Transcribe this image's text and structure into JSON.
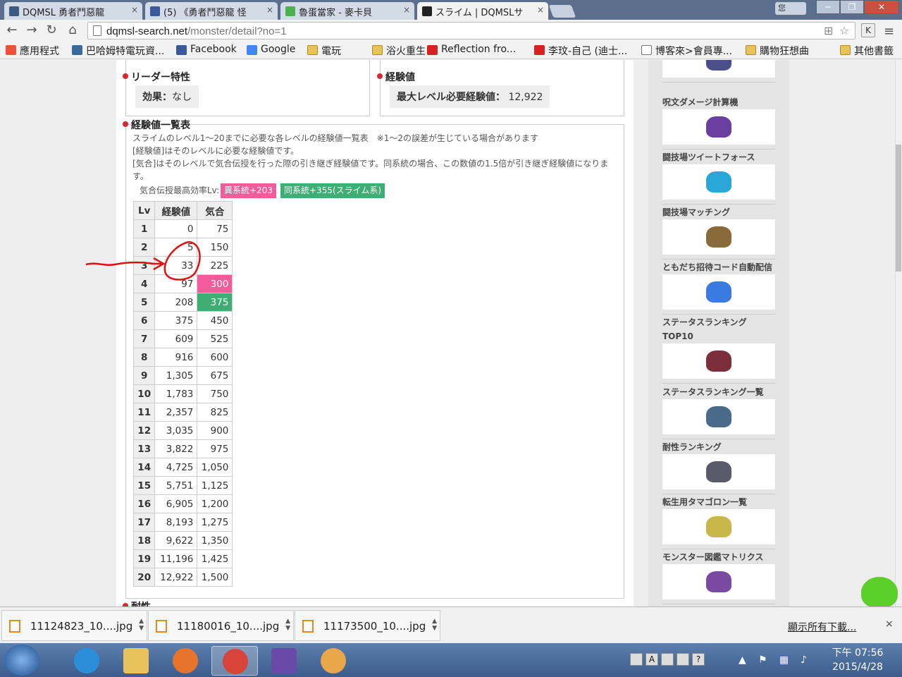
{
  "browser": {
    "tabs": [
      {
        "label": "DQMSL 勇者鬥惡龍",
        "icon_color": "#3c5a80"
      },
      {
        "label": "(5) 《勇者鬥惡龍 怪",
        "icon_color": "#3b5998"
      },
      {
        "label": "魯蛋當家 - 麥卡貝",
        "icon_color": "#4caf50"
      },
      {
        "label": "スライム | DQMSLサ",
        "icon_color": "#222222"
      }
    ],
    "tab_close": "×",
    "user_badge": "您",
    "window_buttons": {
      "minimize": "─",
      "maximize": "❐",
      "close": "✕"
    },
    "url_host": "dqmsl-search.net",
    "url_path": "/monster/detail?no=1",
    "extension_label": "K",
    "bookmarks": [
      {
        "label": "應用程式",
        "kind": "apps"
      },
      {
        "label": "巴哈姆特電玩資...",
        "kind": "site"
      },
      {
        "label": "Facebook",
        "kind": "facebook"
      },
      {
        "label": "Google",
        "kind": "google"
      },
      {
        "label": "電玩",
        "kind": "folder"
      },
      {
        "label": "浴火重生!!!",
        "kind": "folder"
      },
      {
        "label": "Reflection fro...",
        "kind": "youtube"
      },
      {
        "label": "李玟-自己 (迪士...",
        "kind": "youtube"
      },
      {
        "label": "博客來>會員專...",
        "kind": "page"
      },
      {
        "label": "購物狂想曲",
        "kind": "folder"
      },
      {
        "label": "其他書籤",
        "kind": "folder"
      }
    ]
  },
  "page": {
    "leader": {
      "heading": "リーダー特性",
      "label": "効果：",
      "value": "なし"
    },
    "experience": {
      "heading": "経験値",
      "label": "最大レベル必要経験値：",
      "value": "12,922"
    },
    "exp_table": {
      "heading": "経験値一覧表",
      "desc_lines": [
        "スライムのレベル1～20までに必要な各レベルの経験値一覧表　※1～2の誤差が生じている場合があります",
        "[経験値]はそのレベルに必要な経験値です。",
        "[気合]はそのレベルで気合伝授を行った際の引き継ぎ経験値です。同系統の場合、この数値の1.5倍が引き継ぎ経験値になりま",
        "す。"
      ],
      "efficiency_label": "気合伝授最高効率Lv:",
      "tag_other": "異系統+203",
      "tag_same": "同系統+355(スライム系)",
      "columns": [
        "Lv",
        "経験値",
        "気合"
      ],
      "rows": [
        [
          "1",
          "0",
          "75"
        ],
        [
          "2",
          "5",
          "150"
        ],
        [
          "3",
          "33",
          "225"
        ],
        [
          "4",
          "97",
          "300"
        ],
        [
          "5",
          "208",
          "375"
        ],
        [
          "6",
          "375",
          "450"
        ],
        [
          "7",
          "609",
          "525"
        ],
        [
          "8",
          "916",
          "600"
        ],
        [
          "9",
          "1,305",
          "675"
        ],
        [
          "10",
          "1,783",
          "750"
        ],
        [
          "11",
          "2,357",
          "825"
        ],
        [
          "12",
          "3,035",
          "900"
        ],
        [
          "13",
          "3,822",
          "975"
        ],
        [
          "14",
          "4,725",
          "1,050"
        ],
        [
          "15",
          "5,751",
          "1,125"
        ],
        [
          "16",
          "6,905",
          "1,200"
        ],
        [
          "17",
          "8,193",
          "1,275"
        ],
        [
          "18",
          "9,622",
          "1,350"
        ],
        [
          "19",
          "11,196",
          "1,425"
        ],
        [
          "20",
          "12,922",
          "1,500"
        ]
      ],
      "highlight_pink_lv": "4",
      "highlight_green_lv": "5"
    },
    "next_heading": "耐性",
    "sidebar": [
      {
        "label": "",
        "sprite_color": "#4a4f8a"
      },
      {
        "label": "呪文ダメージ計算機",
        "sprite_color": "#6b3fa0"
      },
      {
        "label": "闘技場ツイートフォース",
        "sprite_color": "#2aa7d8"
      },
      {
        "label": "闘技場マッチング",
        "sprite_color": "#8a6a3a"
      },
      {
        "label": "ともだち招待コード自動配信",
        "sprite_color": "#3a7be0"
      },
      {
        "label": "ステータスランキングTOP10",
        "sprite_color": "#7a2f3a"
      },
      {
        "label": "ステータスランキング一覧",
        "sprite_color": "#4a6a8a"
      },
      {
        "label": "耐性ランキング",
        "sprite_color": "#5a5a6a"
      },
      {
        "label": "転生用タマゴロン一覧",
        "sprite_color": "#c8b84a"
      },
      {
        "label": "モンスター図鑑マトリクス",
        "sprite_color": "#7a4aa0"
      }
    ]
  },
  "downloads": {
    "items": [
      "11124823_10....jpg",
      "11180016_10....jpg",
      "11173500_10....jpg"
    ],
    "show_all": "顯示所有下載...",
    "close": "×"
  },
  "taskbar": {
    "apps": [
      {
        "name": "internet-explorer",
        "color": "#2a8fd8"
      },
      {
        "name": "file-explorer",
        "color": "#e8c25a"
      },
      {
        "name": "media-player",
        "color": "#e8732a"
      },
      {
        "name": "chrome",
        "color": "#d8443a"
      },
      {
        "name": "visual-studio",
        "color": "#6a4aa8"
      },
      {
        "name": "paint",
        "color": "#e8a84a"
      }
    ],
    "tray_labels": [
      "A",
      "?"
    ],
    "clock_time": "下午 07:56",
    "clock_date": "2015/4/28"
  }
}
